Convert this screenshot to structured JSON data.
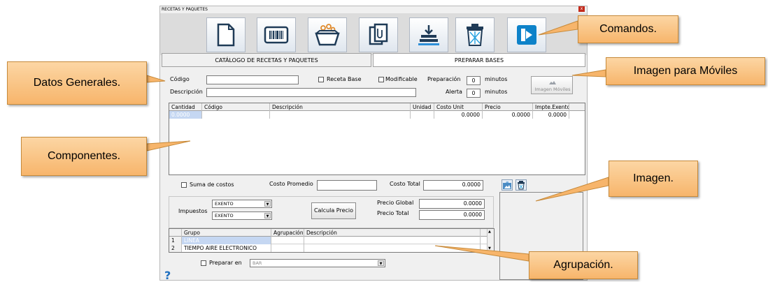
{
  "window": {
    "title": "RECETAS Y PAQUETES",
    "close": "x"
  },
  "toolbar": {
    "icons": [
      "new-document-icon",
      "barcode-icon",
      "basket-icon",
      "copy-clip-icon",
      "stack-download-icon",
      "trash-icon",
      "exit-icon"
    ]
  },
  "tabs": {
    "catalog": "CATÁLOGO DE RECETAS Y PAQUETES",
    "bases": "PREPARAR BASES"
  },
  "form": {
    "codigo_label": "Código",
    "codigo_value": "",
    "descripcion_label": "Descripción",
    "descripcion_value": "",
    "receta_base": "Receta Base",
    "modificable": "Modificable",
    "preparacion_label": "Preparación",
    "preparacion_value": "0",
    "alerta_label": "Alerta",
    "alerta_value": "0",
    "minutos": "minutos",
    "imagen_moviles": "Imagen Móviles"
  },
  "components": {
    "headers": [
      "Cantidad",
      "Código",
      "Descripción",
      "Unidad",
      "Costo Unit",
      "Precio",
      "Impte.Exento"
    ],
    "row": [
      "0.0000",
      "",
      "",
      "",
      "0.0000",
      "0.0000",
      "0.0000"
    ]
  },
  "costs": {
    "suma_costos": "Suma de costos",
    "costo_promedio_label": "Costo Promedio",
    "costo_promedio_value": "",
    "costo_total_label": "Costo Total",
    "costo_total_value": "0.0000"
  },
  "tax": {
    "impuestos_label": "Impuestos",
    "impuesto1": "EXENTO",
    "impuesto2": "EXENTO",
    "calcula_precio": "Calcula Precio",
    "precio_global_label": "Precio Global",
    "precio_global_value": "0.0000",
    "precio_total_label": "Precio Total",
    "precio_total_value": "0.0000"
  },
  "groups": {
    "headers": [
      "Grupo",
      "Agrupación",
      "Descripción"
    ],
    "rows": [
      {
        "num": "1",
        "grupo": "LINEA"
      },
      {
        "num": "2",
        "grupo": "TIEMPO AIRE ELECTRONICO"
      }
    ]
  },
  "prepare": {
    "label": "Preparar en",
    "value": "BAR"
  },
  "help": "?",
  "callouts": {
    "comandos": "Comandos.",
    "datos": "Datos Generales.",
    "imagen_moviles": "Imagen para Móviles",
    "componentes": "Componentes.",
    "imagen": "Imagen.",
    "agrupacion": "Agrupación."
  }
}
